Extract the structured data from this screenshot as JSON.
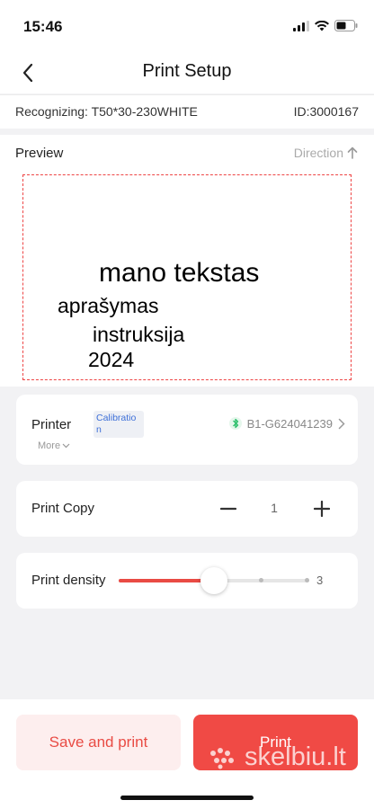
{
  "status": {
    "time": "15:46"
  },
  "nav": {
    "title": "Print Setup",
    "back_icon": "chevron-left-icon"
  },
  "recognize": {
    "label": "Recognizing: T50*30-230WHITE",
    "id": "ID:3000167"
  },
  "preview": {
    "label": "Preview",
    "direction": "Direction",
    "label_lines": [
      "mano tekstas",
      "aprašymas",
      "instruksija",
      "2024"
    ]
  },
  "printer": {
    "label": "Printer",
    "calibration": "Calibration",
    "more": "More",
    "device": "B1-G624041239"
  },
  "copy": {
    "label": "Print Copy",
    "value": "1"
  },
  "density": {
    "label": "Print density",
    "value": "3",
    "fraction": 0.5
  },
  "actions": {
    "save_print": "Save and print",
    "print": "Print"
  },
  "watermark": {
    "text": "skelbiu.lt"
  },
  "colors": {
    "accent": "#f04a45",
    "accent_light": "#fdeeee",
    "bluetooth": "#2bbf6a",
    "link": "#3d6fd8"
  }
}
